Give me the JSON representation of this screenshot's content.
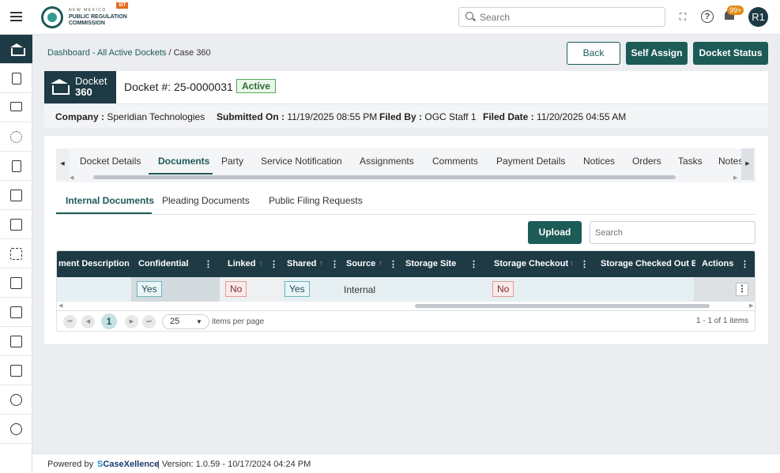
{
  "header": {
    "logo_line_small": "NEW MEXICO",
    "logo_line1": "PUBLIC REGULATION",
    "logo_line2": "COMMISSION",
    "env_badge": "SIT",
    "search_placeholder": "Search",
    "notification_count": "99+",
    "user_initials": "R1"
  },
  "sidebar": {
    "items": [
      "bank-icon",
      "document-icon",
      "chat-icon",
      "loader-icon",
      "dollar-file-icon",
      "building-icon",
      "text-box-icon",
      "scan-icon",
      "book-icon",
      "chart-icon",
      "clipboard-check-icon",
      "calendar-icon",
      "alarm-icon",
      "user-circle-icon"
    ],
    "active_index": 0
  },
  "breadcrumb": {
    "link": "Dashboard - All Active Dockets",
    "separator": " / ",
    "current": "Case 360"
  },
  "actions": {
    "back": "Back",
    "self_assign": "Self Assign",
    "docket_status": "Docket Status"
  },
  "docket": {
    "tile_line1": "Docket",
    "tile_line2": "360",
    "number": "Docket #: 25-0000031",
    "status": "Active",
    "info": {
      "company_label": "Company :",
      "company": "Speridian Technologies",
      "submitted_label": "Submitted On :",
      "submitted": "11/19/2025 08:55 PM",
      "filed_by_label": "Filed By :",
      "filed_by": "OGC Staff 1",
      "filed_date_label": "Filed Date :",
      "filed_date": "11/20/2025 04:55 AM"
    }
  },
  "tabs": [
    "Docket Details",
    "Documents",
    "Party",
    "Service Notification",
    "Assignments",
    "Comments",
    "Payment Details",
    "Notices",
    "Orders",
    "Tasks",
    "Notes"
  ],
  "active_tab": "Documents",
  "subtabs": [
    "Internal Documents",
    "Pleading Documents",
    "Public Filing Requests"
  ],
  "active_subtab": "Internal Documents",
  "toolbar": {
    "upload": "Upload",
    "search_placeholder": "Search"
  },
  "grid": {
    "columns": [
      "ment Description",
      "Confidential",
      "Linked",
      "Shared",
      "Source",
      "Storage Site",
      "Storage Checkout",
      "Storage Checked Out By",
      "Actions"
    ],
    "rows": [
      {
        "description": "",
        "confidential": "Yes",
        "linked": "No",
        "shared": "Yes",
        "source": "Internal",
        "storage_site": "",
        "storage_checkout": "No",
        "storage_checked_out_by": ""
      }
    ]
  },
  "pager": {
    "current_page": "1",
    "page_size": "25",
    "page_size_label": "items per page",
    "count": "1 - 1 of 1 items"
  },
  "footer": {
    "powered_by": "Powered by",
    "brand_mark": "S",
    "brand_name": "CaseXellence",
    "version": "|  Version: 1.0.59 - 10/17/2024 04:24 PM"
  },
  "colors": {
    "primary": "#1d5b57",
    "dark": "#1e3a44",
    "badge": "#e08a14"
  }
}
